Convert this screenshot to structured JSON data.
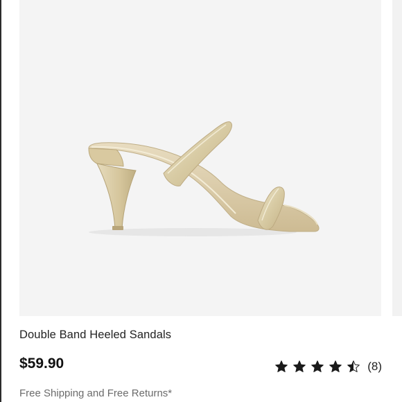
{
  "product": {
    "image_alt": "Double Band Heeled Sandals in metallic gold",
    "title": "Double Band Heeled Sandals",
    "price": "$59.90",
    "rating": {
      "value": 4.5,
      "max": 5,
      "count_label": "(8)"
    },
    "shipping_note": "Free Shipping and Free Returns*"
  },
  "colors": {
    "image_background": "#f4f4f4",
    "sandal_gold": "#d9cdaa",
    "star": "#1a1a1a",
    "muted_text": "#6b6b6b"
  },
  "icons": {
    "star": "star-icon",
    "half_star": "star-half-icon"
  }
}
